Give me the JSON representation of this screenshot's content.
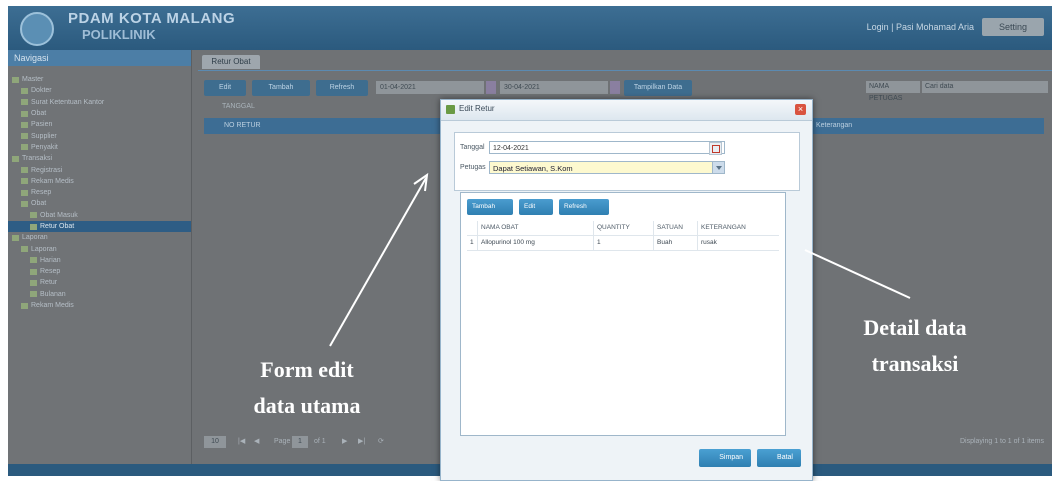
{
  "app": {
    "brand_line1": "PDAM KOTA MALANG",
    "brand_line2": "POLIKLINIK",
    "user_text": "Login | Pasi Mohamad Aria",
    "user_button": "Setting"
  },
  "sidebar": {
    "title": "Navigasi",
    "items": [
      {
        "label": "Master",
        "indent": 0,
        "selected": false
      },
      {
        "label": "Dokter",
        "indent": 1,
        "selected": false
      },
      {
        "label": "Surat Ketentuan Kantor",
        "indent": 1,
        "selected": false
      },
      {
        "label": "Obat",
        "indent": 1,
        "selected": false
      },
      {
        "label": "Pasien",
        "indent": 1,
        "selected": false
      },
      {
        "label": "Supplier",
        "indent": 1,
        "selected": false
      },
      {
        "label": "Penyakit",
        "indent": 1,
        "selected": false
      },
      {
        "label": "Transaksi",
        "indent": 0,
        "selected": false
      },
      {
        "label": "Registrasi",
        "indent": 1,
        "selected": false
      },
      {
        "label": "Rekam Medis",
        "indent": 1,
        "selected": false
      },
      {
        "label": "Resep",
        "indent": 1,
        "selected": false
      },
      {
        "label": "Obat",
        "indent": 1,
        "selected": false
      },
      {
        "label": "Obat Masuk",
        "indent": 2,
        "selected": false
      },
      {
        "label": "Retur Obat",
        "indent": 2,
        "selected": true
      },
      {
        "label": "Laporan",
        "indent": 0,
        "selected": false
      },
      {
        "label": "Laporan",
        "indent": 1,
        "selected": false
      },
      {
        "label": "Harian",
        "indent": 2,
        "selected": false
      },
      {
        "label": "Resep",
        "indent": 2,
        "selected": false
      },
      {
        "label": "Retur",
        "indent": 2,
        "selected": false
      },
      {
        "label": "Bulanan",
        "indent": 2,
        "selected": false
      },
      {
        "label": "Rekam Medis",
        "indent": 1,
        "selected": false
      }
    ]
  },
  "tab": {
    "label": "Retur Obat"
  },
  "toolbar": {
    "edit": "Edit",
    "tambah": "Tambah",
    "refresh": "Refresh",
    "date_from": "01-04-2021",
    "date_to": "30-04-2021",
    "filter": "Tampilkan Data",
    "search_field": "NAMA PETUGAS",
    "search_placeholder": "Cari data"
  },
  "grid": {
    "subheader": "TANGGAL",
    "col_no": "NO RETUR",
    "col_ket": "Keterangan"
  },
  "pager": {
    "page_size": "10",
    "page_label": "Page",
    "page_value": "1",
    "of_label": "of 1",
    "display_text": "Displaying 1 to 1 of 1 items"
  },
  "dialog": {
    "title": "Edit Retur",
    "form": {
      "tanggal_label": "Tanggal",
      "tanggal_value": "12-04-2021",
      "petugas_label": "Petugas",
      "petugas_value": "Dapat Setiawan, S.Kom"
    },
    "detail": {
      "btn_tambah": "Tambah",
      "btn_edit": "Edit",
      "btn_refresh": "Refresh",
      "columns": [
        "NAMA OBAT",
        "QUANTITY",
        "SATUAN",
        "KETERANGAN"
      ],
      "rows": [
        {
          "no": "1",
          "nama": "Allopurinol 100 mg",
          "qty": "1",
          "satuan": "Buah",
          "ket": "rusak"
        }
      ]
    },
    "btn_simpan": "Simpan",
    "btn_batal": "Batal"
  },
  "annotations": {
    "left_line1": "Form edit",
    "left_line2": "data utama",
    "right_line1": "Detail data",
    "right_line2": "transaksi"
  }
}
